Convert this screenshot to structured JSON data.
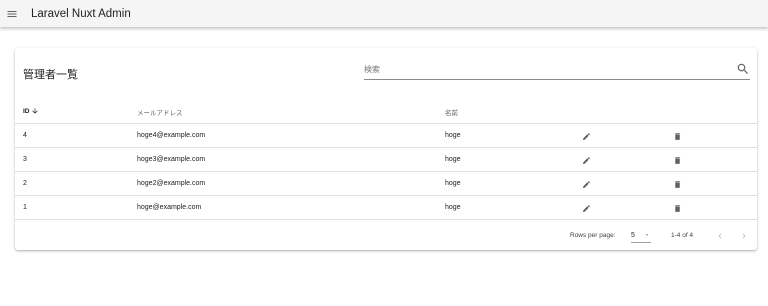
{
  "app": {
    "title": "Laravel Nuxt Admin"
  },
  "card": {
    "title": "管理者一覧"
  },
  "search": {
    "placeholder": "検索",
    "value": ""
  },
  "table": {
    "headers": {
      "id": "ID",
      "email": "メールアドレス",
      "name": "名前"
    },
    "rows": [
      {
        "id": "4",
        "email": "hoge4@example.com",
        "name": "hoge"
      },
      {
        "id": "3",
        "email": "hoge3@example.com",
        "name": "hoge"
      },
      {
        "id": "2",
        "email": "hoge2@example.com",
        "name": "hoge"
      },
      {
        "id": "1",
        "email": "hoge@example.com",
        "name": "hoge"
      }
    ]
  },
  "pagination": {
    "rows_per_page_label": "Rows per page:",
    "rows_per_page_value": "5",
    "range": "1-4 of 4"
  },
  "icons": {
    "menu": "menu-icon",
    "search": "search-icon",
    "sort": "arrow-down-icon",
    "edit": "pencil-icon",
    "delete": "trash-icon",
    "prev": "chevron-left-icon",
    "next": "chevron-right-icon"
  },
  "colors": {
    "appbar": "#f5f5f5",
    "icon": "#616161",
    "disabled": "#bdbdbd"
  }
}
